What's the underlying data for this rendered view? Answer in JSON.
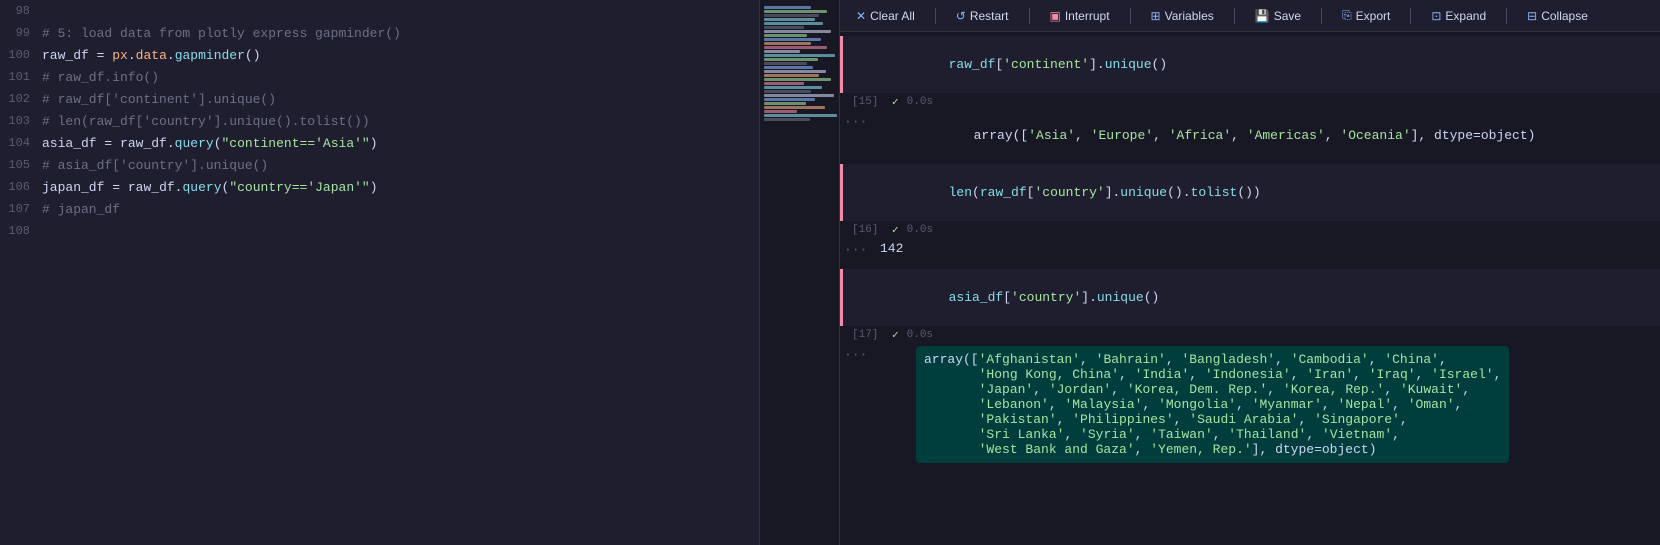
{
  "toolbar": {
    "clear_all": "Clear All",
    "restart": "Restart",
    "interrupt": "Interrupt",
    "variables": "Variables",
    "save": "Save",
    "export": "Export",
    "expand": "Expand",
    "collapse": "Collapse"
  },
  "code_lines": [
    {
      "num": "98",
      "content": "",
      "type": "blank"
    },
    {
      "num": "99",
      "content": "# 5: load data from plotly express gapminder()",
      "type": "comment"
    },
    {
      "num": "100",
      "content": "raw_df = px.data.gapminder()",
      "type": "code"
    },
    {
      "num": "101",
      "content": "# raw_df.info()",
      "type": "comment"
    },
    {
      "num": "102",
      "content": "# raw_df['continent'].unique()",
      "type": "comment"
    },
    {
      "num": "103",
      "content": "# len(raw_df['country'].unique().tolist())",
      "type": "comment"
    },
    {
      "num": "104",
      "content": "asia_df = raw_df.query(\"continent=='Asia'\")",
      "type": "code"
    },
    {
      "num": "105",
      "content": "# asia_df['country'].unique()",
      "type": "comment"
    },
    {
      "num": "106",
      "content": "japan_df = raw_df.query(\"country=='Japan'\")",
      "type": "code"
    },
    {
      "num": "107",
      "content": "# japan_df",
      "type": "comment"
    },
    {
      "num": "108",
      "content": "",
      "type": "blank"
    }
  ],
  "cells": [
    {
      "id": "15",
      "input": "raw_df['continent'].unique()",
      "time": "0.0s",
      "output": "array(['Asia', 'Europe', 'Africa', 'Americas', 'Oceania'], dtype=object)"
    },
    {
      "id": "16",
      "input": "len(raw_df['country'].unique().tolist())",
      "time": "0.0s",
      "output": "142"
    },
    {
      "id": "17",
      "input": "asia_df['country'].unique()",
      "time": "0.0s",
      "output": "array(['Afghanistan', 'Bahrain', 'Bangladesh', 'Cambodia', 'China',\n       'Hong Kong, China', 'India', 'Indonesia', 'Iran', 'Iraq', 'Israel',\n       'Japan', 'Jordan', 'Korea, Dem. Rep.', 'Korea, Rep.', 'Kuwait',\n       'Lebanon', 'Malaysia', 'Mongolia', 'Myanmar', 'Nepal', 'Oman',\n       'Pakistan', 'Philippines', 'Saudi Arabia', 'Singapore',\n       'Sri Lanka', 'Syria', 'Taiwan', 'Thailand', 'Vietnam',\n       'West Bank and Gaza', 'Yemen, Rep.'], dtype=object)"
    }
  ]
}
